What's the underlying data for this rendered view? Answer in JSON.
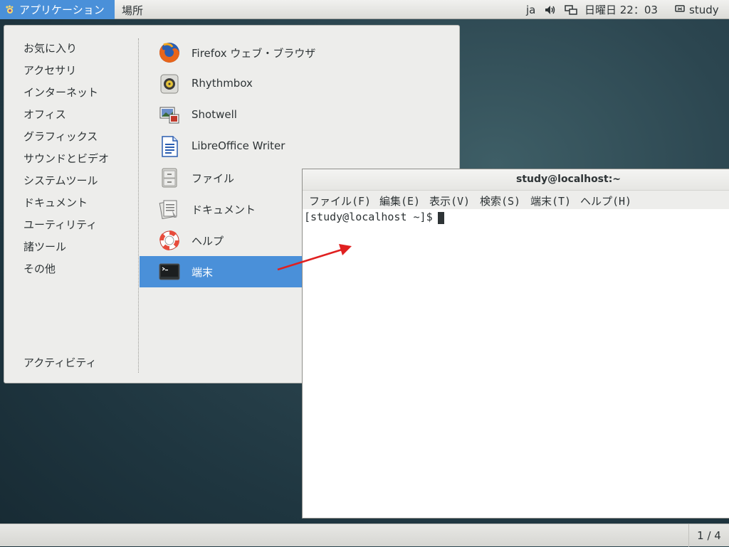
{
  "topbar": {
    "applications_label": "アプリケーション",
    "places_label": "場所",
    "input_method": "ja",
    "clock": "日曜日 22：03",
    "user": "study"
  },
  "menu": {
    "categories": [
      "お気に入り",
      "アクセサリ",
      "インターネット",
      "オフィス",
      "グラフィックス",
      "サウンドとビデオ",
      "システムツール",
      "ドキュメント",
      "ユーティリティ",
      "諸ツール",
      "その他"
    ],
    "activities_label": "アクティビティ",
    "apps": [
      {
        "name": "Firefox ウェブ・ブラウザ",
        "icon": "firefox-icon"
      },
      {
        "name": "Rhythmbox",
        "icon": "rhythmbox-icon"
      },
      {
        "name": "Shotwell",
        "icon": "shotwell-icon"
      },
      {
        "name": "LibreOffice Writer",
        "icon": "writer-icon"
      },
      {
        "name": "ファイル",
        "icon": "files-icon"
      },
      {
        "name": "ドキュメント",
        "icon": "documents-icon"
      },
      {
        "name": "ヘルプ",
        "icon": "help-icon"
      },
      {
        "name": "端末",
        "icon": "terminal-icon",
        "selected": true
      }
    ]
  },
  "terminal": {
    "title": "study@localhost:~",
    "menus": [
      "ファイル(F)",
      "編集(E)",
      "表示(V)",
      "検索(S)",
      "端末(T)",
      "ヘルプ(H)"
    ],
    "prompt": "[study@localhost ~]$"
  },
  "bottombar": {
    "workspace": "1 / 4"
  },
  "colors": {
    "accent": "#4a90d9",
    "annotation_arrow": "#e02020"
  }
}
